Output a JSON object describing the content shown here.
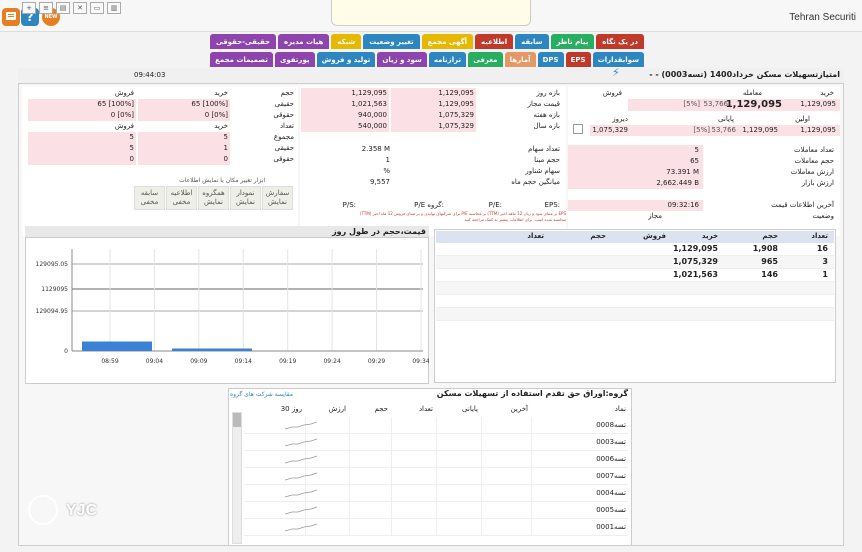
{
  "header": {
    "brand": "Tehran Securiti",
    "new_badge": "NEW",
    "help_icon": "?"
  },
  "tabs_row1": [
    {
      "label": "در یک نگاه",
      "color": "#c0392b"
    },
    {
      "label": "پیام ناظر",
      "color": "#27ae60"
    },
    {
      "label": "سابقه",
      "color": "#2e86c1"
    },
    {
      "label": "اطلاعیه",
      "color": "#c0392b"
    },
    {
      "label": "آگهی مجمع",
      "color": "#e6b800"
    },
    {
      "label": "تغییر وضعیت",
      "color": "#2e86c1"
    },
    {
      "label": "شبکه",
      "color": "#e6b800"
    },
    {
      "label": "هیات مدیره",
      "color": "#8e44ad"
    },
    {
      "label": "حقیقی-حقوقی",
      "color": "#8e44ad"
    }
  ],
  "tabs_row2": [
    {
      "label": "سوابقدارات",
      "color": "#2e86c1"
    },
    {
      "label": "EPS",
      "color": "#c0392b"
    },
    {
      "label": "DPS",
      "color": "#2e86c1"
    },
    {
      "label": "آمارها",
      "color": "#e59866"
    },
    {
      "label": "معرفی",
      "color": "#27ae60"
    },
    {
      "label": "ترازنامه",
      "color": "#2e86c1"
    },
    {
      "label": "سود و زیان",
      "color": "#8e44ad"
    },
    {
      "label": "تولید و فروش",
      "color": "#2e86c1"
    },
    {
      "label": "پورتفوی",
      "color": "#8e44ad"
    },
    {
      "label": "تصمیمات مجمع",
      "color": "#8e44ad"
    }
  ],
  "toolbar": {
    "time": "09:44:03",
    "title": "امتیازتسهیلات مسکن خرداد1400 (تسه0003) - -"
  },
  "quote": {
    "buy_label": "خرید",
    "deal_label": "معامله",
    "sell_label": "فروش",
    "deal_value": "1,129,095",
    "deal_change": "53,766",
    "deal_pct": "[5%]",
    "buy_value": "1,129,095",
    "first_label": "اولین",
    "last_label": "پایانی",
    "yesterday_label": "دیروز",
    "last_value": "1,129,095",
    "last_change": "53,766",
    "last_pct": "[5%]",
    "first_value": "1,129,095",
    "yesterday_value": "1,075,329",
    "trades_count_label": "تعداد معاملات",
    "trades_count": "5",
    "trade_volume_label": "حجم معاملات",
    "trade_volume": "65",
    "trade_value_label": "ارزش معاملات",
    "trade_value": "73.391 M",
    "market_value_label": "ارزش بازار",
    "market_value": "2,662.449 B",
    "last_info_label": "آخرین اطلاعات قیمت",
    "last_info": "09:32:16",
    "status_label": "وضعیت",
    "status": "مجاز"
  },
  "ranges": [
    {
      "label": "بازه روز",
      "a": "1,129,095",
      "b": "1,129,095"
    },
    {
      "label": "قیمت مجاز",
      "a": "1,129,095",
      "b": "1,021,563"
    },
    {
      "label": "بازه هفته",
      "a": "1,075,329",
      "b": "940,000"
    },
    {
      "label": "بازه سال",
      "a": "1,075,329",
      "b": "540,000"
    }
  ],
  "stock_info": [
    {
      "label": "تعداد سهام",
      "value": "2.358 M"
    },
    {
      "label": "حجم مبنا",
      "value": "1"
    },
    {
      "label": "سهام شناور",
      "value": "%"
    },
    {
      "label": "میانگین حجم ماه",
      "value": "9,557"
    }
  ],
  "ratios": {
    "eps": "EPS:",
    "pe": "P/E:",
    "pe_group": "P/E گروه:",
    "ps": "P/S:",
    "note1": "EPS بر مبنای سود و زیان 12 ماهه اخیر (TTM) بر محاسبه P/E برای شرکتهای تولیدی و بر مبنای فروش 12 ماه اخیر (TTM)",
    "note2": "محاسبه شده است. برای اطلاعات بیشتر به کمک مراجعه کنید"
  },
  "client_types": {
    "header": [
      "خرید",
      "فروش"
    ],
    "rows": [
      {
        "label": "حجم",
        "buy": "خرید",
        "sell": "فروش"
      },
      {
        "label": "حقیقی",
        "buy": "65 [100%]",
        "sell": "65 [100%]"
      },
      {
        "label": "حقوقی",
        "buy": "0 [0%]",
        "sell": "0 [0%]"
      },
      {
        "label": "تعداد",
        "buy": "خرید",
        "sell": "فروش"
      },
      {
        "label": "مجموع",
        "buy": "5",
        "sell": "5"
      },
      {
        "label": "حقیقی",
        "buy": "1",
        "sell": "5"
      },
      {
        "label": "حقوقی",
        "buy": "0",
        "sell": "0"
      }
    ]
  },
  "layout_tools": {
    "caption": "ابزار تغییر مکان یا نمایش اطلاعات",
    "buttons": [
      {
        "label": "سفارش",
        "sub": "نمایش"
      },
      {
        "label": "نمودار",
        "sub": "نمایش"
      },
      {
        "label": "همگروه",
        "sub": "نمایش"
      },
      {
        "label": "اطلاعیه",
        "sub": "مخفی"
      },
      {
        "label": "سابقه",
        "sub": "مخفی"
      }
    ]
  },
  "orderbook": {
    "headers": [
      "تعداد",
      "حجم",
      "خرید",
      "فروش",
      "حجم",
      "تعداد"
    ],
    "rows": [
      {
        "count": "16",
        "vol": "1,908",
        "price": "1,129,095"
      },
      {
        "count": "3",
        "vol": "965",
        "price": "1,075,329"
      },
      {
        "count": "1",
        "vol": "146",
        "price": "1,021,563"
      }
    ]
  },
  "chart_data": {
    "type": "line",
    "title": "قیمت،حجم در طول روز",
    "xlabel": "",
    "ylabel": "",
    "x_ticks": [
      "08:59",
      "09:04",
      "09:09",
      "09:14",
      "09:19",
      "09:24",
      "09:29",
      "09:34"
    ],
    "y_ticks": [
      "129095.05",
      "1129095",
      "129094.95",
      "0"
    ],
    "series": [
      {
        "values": [
          1129095,
          1129095,
          1129095,
          1129095,
          1129095,
          1129095,
          1129095,
          1129095
        ]
      }
    ],
    "volume_bars": [
      {
        "x": "09:01",
        "value": 0.95
      },
      {
        "x": "09:10",
        "value": 0.25
      }
    ],
    "grid": true
  },
  "group": {
    "title": "گروه:اوراق حق تقدم استفاده از تسهیلات مسکن",
    "compare_link": "مقایسه شرکت های گروه",
    "headers": [
      "نماد",
      "آخرین",
      "پایانی",
      "تعداد",
      "حجم",
      "ارزش",
      "30 روز"
    ],
    "rows": [
      "تسه0008",
      "تسه0003",
      "تسه0006",
      "تسه0007",
      "تسه0004",
      "تسه0005",
      "تسه0001"
    ]
  },
  "watermark": "YJC"
}
